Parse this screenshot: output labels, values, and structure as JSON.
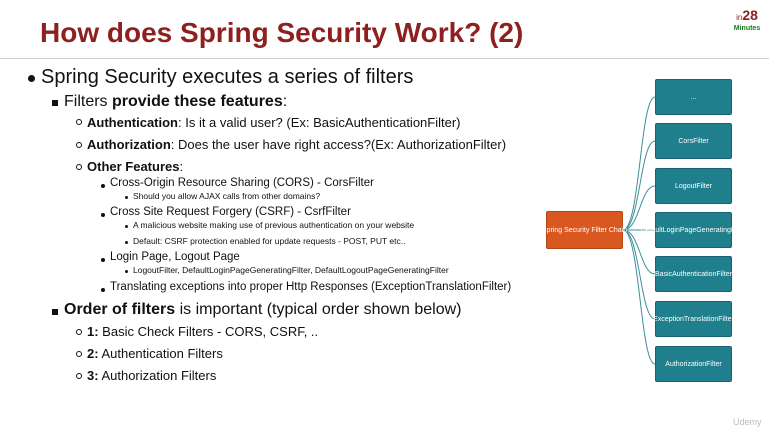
{
  "slide": {
    "title": "How does Spring Security Work? (2)",
    "logo": {
      "prefix": "in",
      "number": "28",
      "suffix": "Minutes"
    },
    "watermark": "Udemy"
  },
  "content": {
    "l1_main": "Spring Security executes a series of filters",
    "l2_features_pre": "Filters ",
    "l2_features_bold": "provide these features",
    "l2_features_post": ":",
    "auth_bold": "Authentication",
    "auth_rest": ": Is it a valid user? (Ex: BasicAuthenticationFilter)",
    "authz_bold": "Authorization",
    "authz_rest": ": Does the user have right access?(Ex: AuthorizationFilter)",
    "other_bold": "Other Features",
    "other_rest": ":",
    "cors": "Cross-Origin Resource Sharing (CORS) - CorsFilter",
    "cors_q": "Should you allow AJAX calls from other domains?",
    "csrf": "Cross Site Request Forgery (CSRF) - CsrfFilter",
    "csrf_1": "A malicious website making use of previous authentication on your website",
    "csrf_2": "Default: CSRF protection enabled for update requests - POST, PUT etc..",
    "login": "Login Page, Logout Page",
    "login_1": "LogoutFilter, DefaultLoginPageGeneratingFilter, DefaultLogoutPageGeneratingFilter",
    "translate": "Translating exceptions into proper Http Responses (ExceptionTranslationFilter)",
    "order_bold": "Order of filters",
    "order_rest": " is important (typical order shown below)",
    "o1_bold": "1:",
    "o1_rest": " Basic Check Filters - CORS, CSRF, ..",
    "o2_bold": "2:",
    "o2_rest": " Authentication Filters",
    "o3_bold": "3:",
    "o3_rest": " Authorization Filters"
  },
  "diagram": {
    "root": "Spring Security Filter Chain",
    "filters": [
      "...",
      "CorsFilter",
      "LogoutFilter",
      "DefaultLoginPageGeneratingFilter",
      "BasicAuthenticationFilter",
      "ExceptionTranslationFilter",
      "AuthorizationFilter"
    ],
    "colors": {
      "root": "#d9581f",
      "filter": "#1f7f8c",
      "title": "#8e2020"
    }
  }
}
